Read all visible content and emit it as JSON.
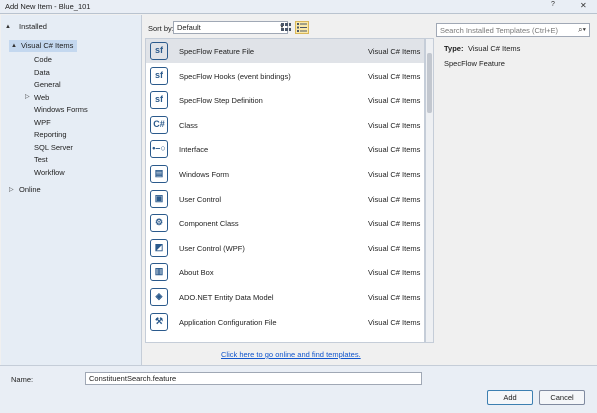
{
  "window": {
    "title": "Add New Item - Blue_101",
    "help_glyph": "?",
    "close_glyph": "✕"
  },
  "tree": {
    "installed": "Installed",
    "visual_csharp": "Visual C# Items",
    "children": [
      "Code",
      "Data",
      "General",
      "Web",
      "Windows Forms",
      "WPF",
      "Reporting",
      "SQL Server",
      "Test",
      "Workflow"
    ],
    "online": "Online"
  },
  "toolbar": {
    "sort_label": "Sort by:",
    "sort_value": "Default"
  },
  "search": {
    "placeholder": "Search Installed Templates (Ctrl+E)"
  },
  "templates": [
    {
      "name": "SpecFlow Feature File",
      "type": "Visual C# Items",
      "icon": "specflow-icon",
      "glyph": "sf"
    },
    {
      "name": "SpecFlow Hooks (event bindings)",
      "type": "Visual C# Items",
      "icon": "specflow-icon",
      "glyph": "sf"
    },
    {
      "name": "SpecFlow Step Definition",
      "type": "Visual C# Items",
      "icon": "specflow-icon",
      "glyph": "sf"
    },
    {
      "name": "Class",
      "type": "Visual C# Items",
      "icon": "class-icon",
      "glyph": "C#"
    },
    {
      "name": "Interface",
      "type": "Visual C# Items",
      "icon": "interface-icon",
      "glyph": "•–○"
    },
    {
      "name": "Windows Form",
      "type": "Visual C# Items",
      "icon": "form-icon",
      "glyph": "▤"
    },
    {
      "name": "User Control",
      "type": "Visual C# Items",
      "icon": "user-control-icon",
      "glyph": "▣"
    },
    {
      "name": "Component Class",
      "type": "Visual C# Items",
      "icon": "component-icon",
      "glyph": "⚙"
    },
    {
      "name": "User Control (WPF)",
      "type": "Visual C# Items",
      "icon": "wpf-user-control-icon",
      "glyph": "◩"
    },
    {
      "name": "About Box",
      "type": "Visual C# Items",
      "icon": "about-box-icon",
      "glyph": "▥"
    },
    {
      "name": "ADO.NET Entity Data Model",
      "type": "Visual C# Items",
      "icon": "entity-model-icon",
      "glyph": "◈"
    },
    {
      "name": "Application Configuration File",
      "type": "Visual C# Items",
      "icon": "config-file-icon",
      "glyph": "⚒"
    }
  ],
  "online_link": "Click here to go online and find templates.",
  "detail": {
    "type_label": "Type:",
    "type_value": "Visual C# Items",
    "description": "SpecFlow Feature"
  },
  "name_field": {
    "label": "Name:",
    "value": "ConstituentSearch.feature"
  },
  "buttons": {
    "add": "Add",
    "cancel": "Cancel"
  },
  "colors": {
    "accent": "#1155cc",
    "selection": "#c4d8ef",
    "icon": "#2b5a8c"
  }
}
